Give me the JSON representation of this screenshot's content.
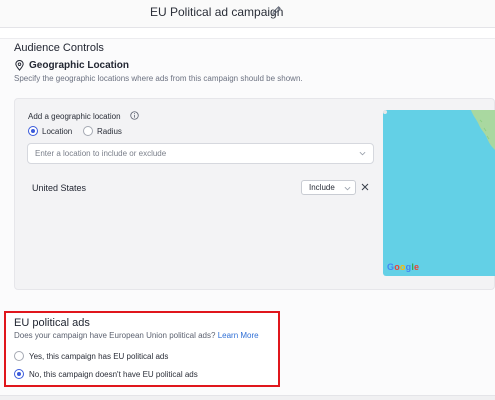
{
  "header": {
    "campaign_title": "EU Political ad campaign",
    "edit_icon": "pencil-icon"
  },
  "audience": {
    "section_title": "Audience Controls",
    "geo": {
      "icon": "map-pin-icon",
      "title": "Geographic Location",
      "description": "Specify the geographic locations where ads from this campaign should be shown.",
      "add_label": "Add a geographic location",
      "info_icon": "info-icon",
      "modes": [
        {
          "label": "Location",
          "selected": true
        },
        {
          "label": "Radius",
          "selected": false
        }
      ],
      "input_placeholder": "Enter a location to include or exclude",
      "input_value": "",
      "locations": [
        {
          "name": "United States",
          "action": "Include"
        }
      ],
      "map_attribution": "Google"
    }
  },
  "eu_political": {
    "title": "EU political ads",
    "question": "Does your campaign have European Union political ads?",
    "learn_more": "Learn More",
    "options": [
      {
        "label": "Yes, this campaign has EU political ads",
        "selected": false
      },
      {
        "label": "No, this campaign doesn't have EU political ads",
        "selected": true
      }
    ],
    "highlight_color": "#e0161c"
  },
  "colors": {
    "accent": "#3b5bdb",
    "link": "#2f6fd6",
    "map_water": "#63d0e6"
  }
}
